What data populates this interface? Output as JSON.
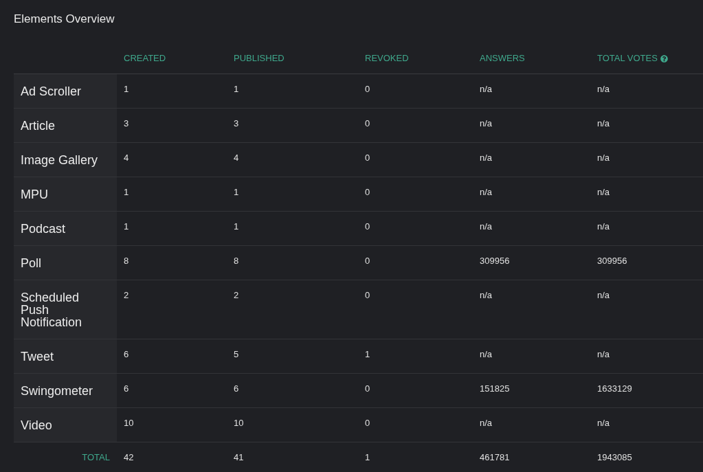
{
  "title": "Elements Overview",
  "table": {
    "columns": [
      {
        "label": "CREATED",
        "help_icon": false
      },
      {
        "label": "PUBLISHED",
        "help_icon": false
      },
      {
        "label": "REVOKED",
        "help_icon": false
      },
      {
        "label": "ANSWERS",
        "help_icon": false
      },
      {
        "label": "TOTAL VOTES",
        "help_icon": true
      }
    ],
    "rows": [
      {
        "label": "Ad Scroller",
        "values": [
          "1",
          "1",
          "0",
          "n/a",
          "n/a"
        ]
      },
      {
        "label": "Article",
        "values": [
          "3",
          "3",
          "0",
          "n/a",
          "n/a"
        ]
      },
      {
        "label": "Image Gallery",
        "values": [
          "4",
          "4",
          "0",
          "n/a",
          "n/a"
        ]
      },
      {
        "label": "MPU",
        "values": [
          "1",
          "1",
          "0",
          "n/a",
          "n/a"
        ]
      },
      {
        "label": "Podcast",
        "values": [
          "1",
          "1",
          "0",
          "n/a",
          "n/a"
        ]
      },
      {
        "label": "Poll",
        "values": [
          "8",
          "8",
          "0",
          "309956",
          "309956"
        ]
      },
      {
        "label": "Scheduled Push Notification",
        "values": [
          "2",
          "2",
          "0",
          "n/a",
          "n/a"
        ]
      },
      {
        "label": "Tweet",
        "values": [
          "6",
          "5",
          "1",
          "n/a",
          "n/a"
        ]
      },
      {
        "label": "Swingometer",
        "values": [
          "6",
          "6",
          "0",
          "151825",
          "1633129"
        ]
      },
      {
        "label": "Video",
        "values": [
          "10",
          "10",
          "0",
          "n/a",
          "n/a"
        ]
      }
    ],
    "total": {
      "label": "TOTAL",
      "values": [
        "42",
        "41",
        "1",
        "461781",
        "1943085"
      ]
    }
  }
}
